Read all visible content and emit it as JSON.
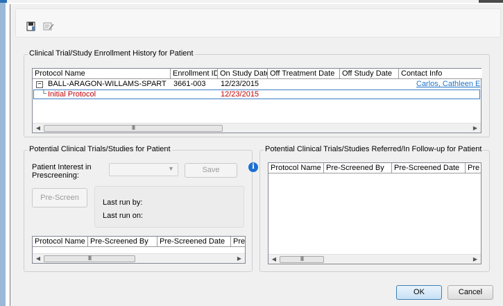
{
  "toolbar": {
    "icons": [
      "save-icon",
      "edit-icon"
    ]
  },
  "enrollment_history": {
    "title": "Clinical Trial/Study Enrollment History for Patient",
    "columns": [
      "Protocol Name",
      "Enrollment ID",
      "On Study Date",
      "Off Treatment Date",
      "Off Study Date",
      "Contact Info"
    ],
    "rows": [
      {
        "expander": "−",
        "protocol_name": "BALL-ARAGON-WILLAMS-SPART",
        "enrollment_id": "3661-003",
        "on_study_date": "12/23/2015",
        "off_treatment_date": "",
        "off_study_date": "",
        "contact_info": "Carlos, Cathleen E"
      },
      {
        "tree_connector": "└",
        "protocol_name": "Initial Protocol",
        "on_study_date": "12/23/2015",
        "text_color": "#c00000"
      }
    ],
    "scroll_thumb": "III"
  },
  "potential": {
    "title": "Potential Clinical Trials/Studies for Patient",
    "interest_label": "Patient Interest in Prescreening:",
    "interest_value": "",
    "save_label": "Save",
    "prescreen_label": "Pre-Screen",
    "last_run_by_label": "Last run by:",
    "last_run_on_label": "Last run on:",
    "columns": [
      "Protocol Name",
      "Pre-Screened By",
      "Pre-Screened Date",
      "Pre"
    ],
    "scroll_thumb": "III"
  },
  "referred": {
    "title": "Potential Clinical Trials/Studies Referred/In Follow-up for Patient",
    "columns": [
      "Protocol Name",
      "Pre-Screened By",
      "Pre-Screened Date",
      "Pre"
    ],
    "scroll_thumb": "III"
  },
  "footer": {
    "ok_label": "OK",
    "cancel_label": "Cancel"
  },
  "colors": {
    "selection_border": "#3a7cc5",
    "link": "#1f73c9",
    "info_icon": "#1c6fd0",
    "child_row_text": "#c00000"
  }
}
